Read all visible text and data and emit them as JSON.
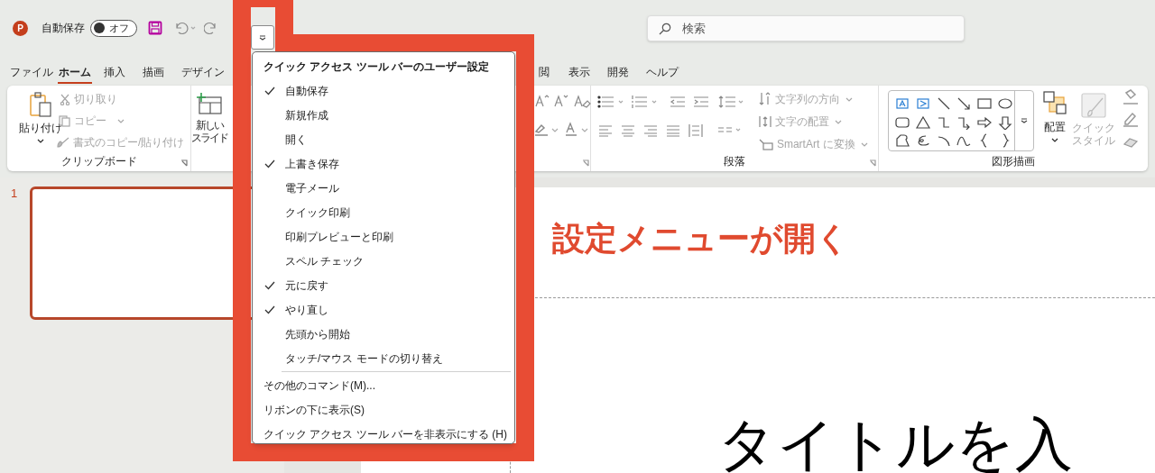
{
  "title_bar": {
    "app_logo": "P",
    "autosave_label": "自動保存",
    "autosave_toggle": {
      "label": "オフ",
      "on": false
    },
    "search": {
      "placeholder": "検索"
    }
  },
  "tabs": [
    {
      "label": "ファイル",
      "selected": false
    },
    {
      "label": "ホーム",
      "selected": true
    },
    {
      "label": "挿入",
      "selected": false
    },
    {
      "label": "描画",
      "selected": false
    },
    {
      "label": "デザイン",
      "selected": false
    },
    {
      "label": "閲",
      "selected": false
    },
    {
      "label": "表示",
      "selected": false
    },
    {
      "label": "開発",
      "selected": false
    },
    {
      "label": "ヘルプ",
      "selected": false
    }
  ],
  "ribbon": {
    "clipboard": {
      "label": "クリップボード",
      "paste": {
        "label": "貼り付け",
        "disabled": false
      },
      "cut": {
        "label": "切り取り",
        "disabled": true
      },
      "copy": {
        "label": "コピー",
        "disabled": true
      },
      "format_painter": {
        "label": "書式のコピー/貼り付け",
        "disabled": true
      }
    },
    "slides": {
      "new_slide": {
        "label_1": "新しい",
        "label_2": "スライド",
        "disabled": false
      }
    },
    "paragraph": {
      "label": "段落",
      "text_direction": {
        "label": "文字列の方向",
        "disabled": true
      },
      "align_text": {
        "label": "文字の配置",
        "disabled": true
      },
      "smartart": {
        "label": "SmartArt に変換",
        "disabled": true
      }
    },
    "drawing": {
      "label": "図形描画",
      "arrange": {
        "label": "配置",
        "disabled": false
      },
      "quick_styles": {
        "label_1": "クイック",
        "label_2": "スタイル",
        "disabled": true
      }
    }
  },
  "slides": [
    {
      "number": "1",
      "selected": true
    }
  ],
  "qat_menu": {
    "title": "クイック アクセス ツール バーのユーザー設定",
    "items": [
      {
        "label": "自動保存",
        "checked": true
      },
      {
        "label": "新規作成",
        "checked": false
      },
      {
        "label": "開く",
        "checked": false
      },
      {
        "label": "上書き保存",
        "checked": true
      },
      {
        "label": "電子メール",
        "checked": false
      },
      {
        "label": "クイック印刷",
        "checked": false
      },
      {
        "label": "印刷プレビューと印刷",
        "checked": false
      },
      {
        "label": "スペル チェック",
        "checked": false
      },
      {
        "label": "元に戻す",
        "checked": true
      },
      {
        "label": "やり直し",
        "checked": true
      },
      {
        "label": "先頭から開始",
        "checked": false
      },
      {
        "label": "タッチ/マウス モードの切り替え",
        "checked": false
      }
    ],
    "commands": [
      "その他のコマンド(M)...",
      "リボンの下に表示(S)",
      "クイック アクセス ツール バーを非表示にする (H)"
    ]
  },
  "annotation": "設定メニューが開く",
  "slide_title_placeholder": "タイトルを入"
}
